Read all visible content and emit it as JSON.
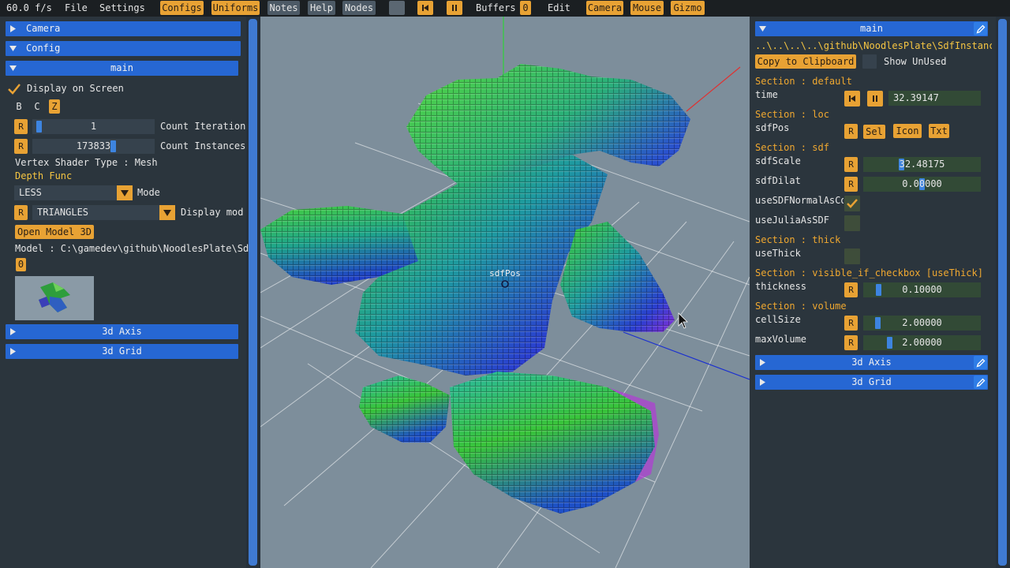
{
  "menubar": {
    "fps": "60.0 f/s",
    "file": "File",
    "settings": "Settings",
    "configs": "Configs",
    "uniforms": "Uniforms",
    "notes": "Notes",
    "help": "Help",
    "nodes": "Nodes",
    "buffers_label": "Buffers",
    "buffers_count": "0",
    "edit": "Edit",
    "camera": "Camera",
    "mouse": "Mouse",
    "gizmo": "Gizmo"
  },
  "left_panel": {
    "camera_header": "Camera",
    "config_header": "Config",
    "main_header": "main",
    "display_on_screen": "Display on Screen",
    "btn_b": "B",
    "btn_c": "C",
    "btn_z": "Z",
    "reset": "R",
    "count_iteration_value": "1",
    "count_iteration_label": "Count Iteration",
    "count_instances_value": "173833",
    "count_instances_label": "Count Instances",
    "vertex_shader_type": "Vertex Shader Type : Mesh",
    "depth_func_title": "Depth Func",
    "depth_mode_value": "LESS",
    "depth_mode_label": "Mode",
    "display_mode_value": "TRIANGLES",
    "display_mode_label": "Display mod",
    "open_model_button": "Open Model 3D",
    "model_path": "Model : C:\\gamedev\\github\\NoodlesPlate\\Sd",
    "model_index": "0",
    "axis_header": "3d Axis",
    "grid_header": "3d Grid"
  },
  "viewport": {
    "gizmo_label": "sdfPos"
  },
  "right_panel": {
    "main_header": "main",
    "path": "..\\..\\..\\..\\github\\NoodlesPlate\\SdfInstanci",
    "copy_button": "Copy to Clipboard",
    "show_unused": "Show UnUsed",
    "reset": "R",
    "sections": {
      "default": "Section : default",
      "loc": "Section : loc",
      "sdf": "Section : sdf",
      "thick": "Section : thick",
      "visible": "Section : visible_if_checkbox [useThick]",
      "volume": "Section : volume"
    },
    "time_label": "time",
    "time_value": "32.39147",
    "sdfpos_label": "sdfPos",
    "sel_button": "Sel",
    "icon_button": "Icon",
    "txt_button": "Txt",
    "sdfscale_label": "sdfScale",
    "sdfscale_value": "32.48175",
    "sdfdilat_label": "sdfDilat",
    "sdfdilat_value": "0.00000",
    "usesdfnormal_label": "useSDFNormalAsCo",
    "usejulia_label": "useJuliaAsSDF",
    "usethick_label": "useThick",
    "thickness_label": "thickness",
    "thickness_value": "0.10000",
    "cellsize_label": "cellSize",
    "cellsize_value": "2.00000",
    "maxvolume_label": "maxVolume",
    "maxvolume_value": "2.00000",
    "axis_header": "3d Axis",
    "grid_header": "3d Grid"
  },
  "colors": {
    "accent": "#e8a234",
    "header": "#2667d3",
    "panel": "#2b353d",
    "menubar": "#1b1f22",
    "section_text": "#f0a830",
    "viewport_bg": "#7d8e9b"
  },
  "icons": {
    "rewind": "skip-back-icon",
    "pause": "pause-icon",
    "edit": "pencil-icon",
    "check": "checkmark-icon",
    "expand": "triangle-down-icon",
    "collapse": "triangle-right-icon"
  }
}
